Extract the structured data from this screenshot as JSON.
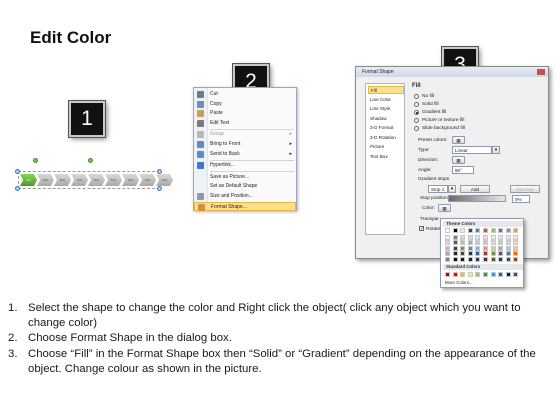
{
  "title": "Edit Color",
  "steps": [
    "1",
    "2",
    "3"
  ],
  "shape": {
    "segments": [
      "Ga",
      "Text",
      "Text",
      "Text",
      "Text",
      "Text",
      "Text",
      "Text",
      "Text"
    ]
  },
  "context_menu": {
    "items": [
      {
        "label": "Cut",
        "underline": "t",
        "icon": "scissors-icon",
        "disabled": false,
        "submenu": false
      },
      {
        "label": "Copy",
        "icon": "copy-icon",
        "disabled": false,
        "submenu": false
      },
      {
        "label": "Paste",
        "icon": "paste-icon",
        "disabled": false,
        "submenu": false
      },
      {
        "label": "Edit Text",
        "icon": "edit-text-icon",
        "disabled": false,
        "submenu": false
      },
      {
        "label": "Group",
        "icon": "group-icon",
        "disabled": true,
        "submenu": true
      },
      {
        "label": "Bring to Front",
        "icon": "bring-front-icon",
        "disabled": false,
        "submenu": true
      },
      {
        "label": "Send to Back",
        "icon": "send-back-icon",
        "disabled": false,
        "submenu": true
      },
      {
        "label": "Hyperlink...",
        "icon": "hyperlink-icon",
        "disabled": false,
        "submenu": false
      },
      {
        "label": "Save as Picture...",
        "icon": "",
        "disabled": false,
        "submenu": false
      },
      {
        "label": "Set as Default Shape",
        "icon": "",
        "disabled": false,
        "submenu": false
      },
      {
        "label": "Size and Position...",
        "icon": "size-position-icon",
        "disabled": false,
        "submenu": false
      },
      {
        "label": "Format Shape...",
        "icon": "format-shape-icon",
        "disabled": false,
        "submenu": false,
        "highlighted": true
      }
    ]
  },
  "dialog": {
    "title": "Format Shape",
    "sidebar": [
      "Fill",
      "Line Color",
      "Line Style",
      "Shadow",
      "3-D Format",
      "3-D Rotation",
      "Picture",
      "Text Box"
    ],
    "selected_sidebar": "Fill",
    "heading": "Fill",
    "fill_options": [
      {
        "label": "No fill",
        "selected": false
      },
      {
        "label": "Solid fill",
        "selected": false
      },
      {
        "label": "Gradient fill",
        "selected": true
      },
      {
        "label": "Picture or texture fill",
        "selected": false
      },
      {
        "label": "Slide background fill",
        "selected": false
      }
    ],
    "preset_colors_label": "Preset colors:",
    "type_label": "Type:",
    "type_value": "Linear",
    "direction_label": "Direction:",
    "angle_label": "Angle:",
    "angle_value": "90°",
    "gradient_stops_label": "Gradient stops",
    "stop_value": "Stop 1",
    "add_label": "Add",
    "remove_label": "Remove",
    "stop_position_label": "Stop position:",
    "stop_position_value": "0%",
    "color_label": "Color:",
    "transparency_label": "Transpar",
    "rotate_label": "Rotate"
  },
  "palette": {
    "theme_header": "Theme Colors",
    "standard_header": "Standard Colors",
    "more_label": "More Colors...",
    "theme_top": [
      "#ffffff",
      "#000000",
      "#eeece1",
      "#1f497d",
      "#4f81bd",
      "#c0504d",
      "#9bbb59",
      "#8064a2",
      "#4bacc6",
      "#f79646"
    ],
    "theme_shade_cols": [
      [
        "#f2f2f2",
        "#d9d9d9",
        "#bfbfbf",
        "#a6a6a6",
        "#808080"
      ],
      [
        "#7f7f7f",
        "#595959",
        "#404040",
        "#262626",
        "#0d0d0d"
      ],
      [
        "#ddd9c3",
        "#c4bd97",
        "#948a54",
        "#4a452a",
        "#1d1b10"
      ],
      [
        "#c6d9f0",
        "#8db3e2",
        "#548dd4",
        "#17365d",
        "#0f243e"
      ],
      [
        "#dbe5f1",
        "#b8cce4",
        "#95b3d7",
        "#366092",
        "#244061"
      ],
      [
        "#f2dcdb",
        "#e5b9b7",
        "#d99694",
        "#953734",
        "#632423"
      ],
      [
        "#ebf1dd",
        "#d7e3bc",
        "#c3d69b",
        "#76923c",
        "#4f6128"
      ],
      [
        "#e5e0ec",
        "#ccc1d9",
        "#b2a2c7",
        "#5f497a",
        "#3f3151"
      ],
      [
        "#dbeef3",
        "#b7dde8",
        "#92cddc",
        "#31859b",
        "#205867"
      ],
      [
        "#fdeada",
        "#fbd5b5",
        "#fac08f",
        "#e36c09",
        "#974806"
      ]
    ],
    "standard": [
      "#c00000",
      "#ff0000",
      "#ffc000",
      "#ffff00",
      "#92d050",
      "#00b050",
      "#00b0f0",
      "#0070c0",
      "#002060",
      "#7030a0"
    ]
  },
  "instructions": [
    {
      "num": "1.",
      "text": "Select the shape to change the color and Right click the object( click any object which you want to change color)"
    },
    {
      "num": "2.",
      "text": "Choose Format Shape in the dialog box."
    },
    {
      "num": "3.",
      "text": "Choose “Fill” in the Format Shape box then “Solid” or “Gradient” depending on the appearance of the object. Change colour as shown in the picture."
    }
  ]
}
